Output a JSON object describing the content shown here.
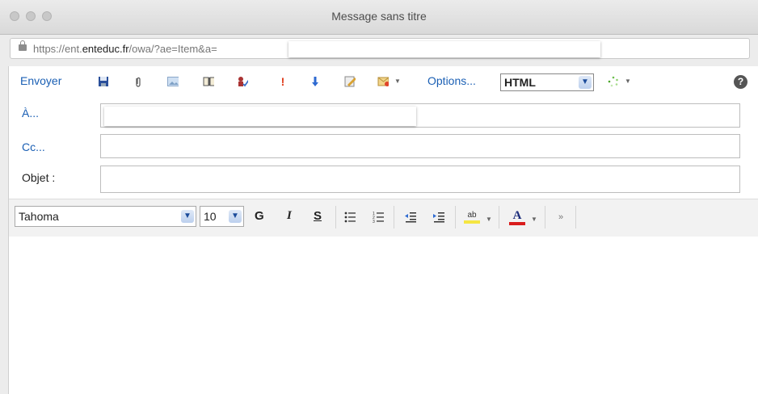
{
  "window": {
    "title": "Message sans titre"
  },
  "address": {
    "url_prefix": "https://ent.",
    "url_domain": "enteduc.fr",
    "url_suffix": "/owa/?ae=Item&a="
  },
  "toolbar": {
    "send_label": "Envoyer",
    "options_label": "Options...",
    "format_value": "HTML",
    "icons": [
      "save-icon",
      "attach-icon",
      "insert-image-icon",
      "address-book-icon",
      "check-names-icon",
      "importance-high-icon",
      "importance-low-icon",
      "spell-check-icon",
      "message-flag-icon",
      "loading-icon",
      "help-icon"
    ]
  },
  "fields": {
    "to_label": "À...",
    "cc_label": "Cc...",
    "subject_label": "Objet :"
  },
  "format_bar": {
    "font_value": "Tahoma",
    "size_value": "10",
    "bold_label": "G",
    "italic_label": "I",
    "underline_label": "S",
    "highlight_label": "ab",
    "font_color_label": "A"
  },
  "colors": {
    "link": "#1a5fb4",
    "highlight": "#f5e642",
    "font_color": "#d91c1c"
  }
}
